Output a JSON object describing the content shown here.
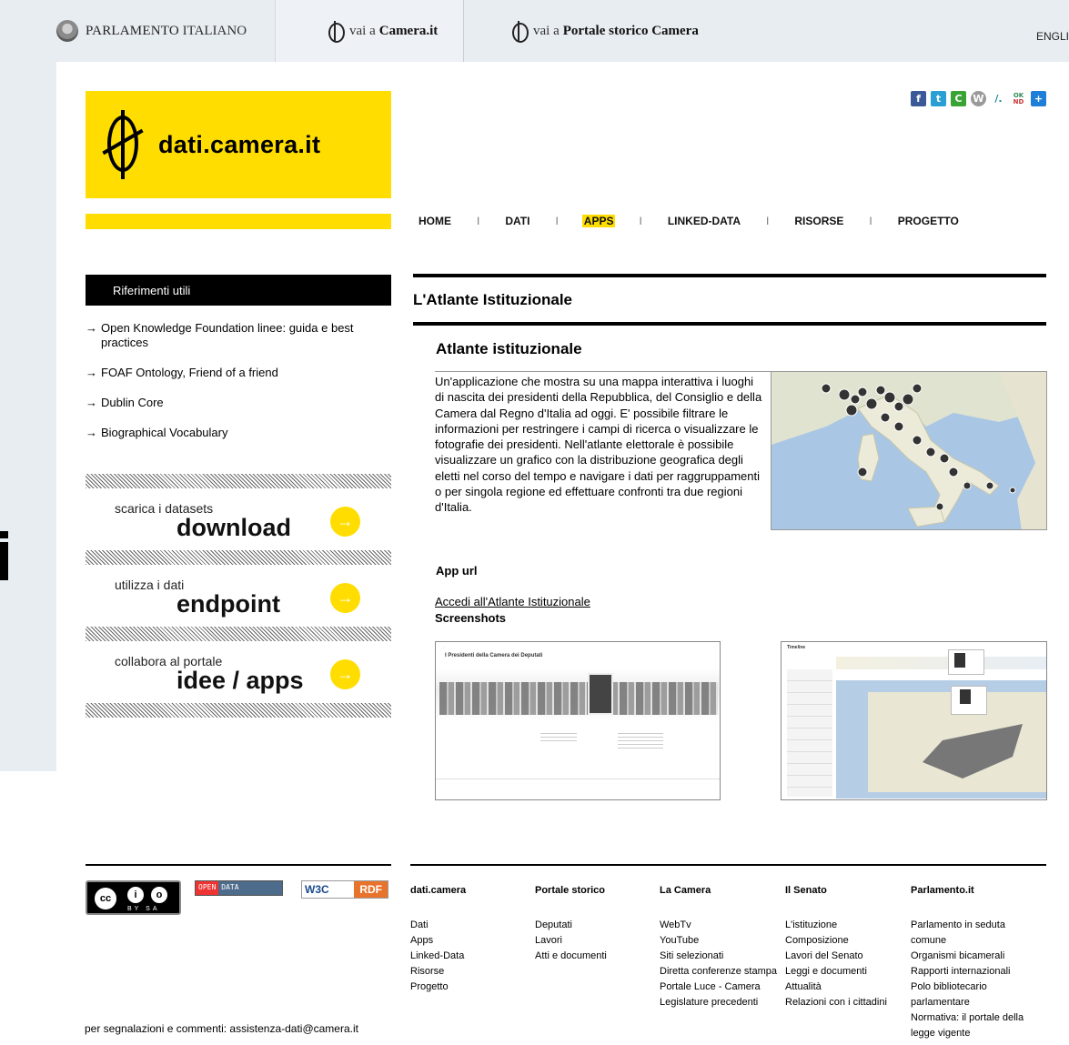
{
  "topbar": {
    "parlamento_strong": "PARLAMENTO",
    "parlamento_rest": "ITALIANO",
    "camera_prefix": "vai a",
    "camera_label": "Camera.it",
    "storico_prefix": "vai a",
    "storico_label": "Portale storico Camera",
    "lang": "ENGLI"
  },
  "logo": {
    "text": "dati.camera.it"
  },
  "social_icons": [
    "facebook-icon",
    "twitter-icon",
    "identica-icon",
    "wordpress-icon",
    "slash-icon",
    "okfn-icon",
    "add-icon"
  ],
  "nav": {
    "items": [
      {
        "label": "HOME"
      },
      {
        "label": "DATI"
      },
      {
        "label": "APPS",
        "active": true
      },
      {
        "label": "LINKED-DATA"
      },
      {
        "label": "RISORSE"
      },
      {
        "label": "PROGETTO"
      }
    ],
    "separator": "I"
  },
  "sidebar": {
    "heading": "Riferimenti utili",
    "links": [
      "Open Knowledge Foundation linee: guida e best practices",
      "FOAF Ontology, Friend of a friend",
      "Dublin Core",
      "Biographical Vocabulary"
    ],
    "arrow": "→",
    "blocks": [
      {
        "small": "scarica i datasets",
        "big": "download",
        "btn": "→"
      },
      {
        "small": "utilizza i dati",
        "big": "endpoint",
        "btn": "→"
      },
      {
        "small": "collabora al portale",
        "big": "idee / apps",
        "btn": "→"
      }
    ]
  },
  "main": {
    "page_title": "L'Atlante Istituzionale",
    "app_title": "Atlante istituzionale",
    "description": "Un'applicazione che mostra su una mappa interattiva i luoghi di nascita dei presidenti della Repubblica, del Consiglio e della Camera dal Regno d'Italia ad oggi. E' possibile filtrare le informazioni per restringere i campi di ricerca o visualizzare le fotografie dei presidenti. Nell'atlante elettorale è possibile visualizzare un grafico con la distribuzione geografica degli eletti nel corso del tempo e navigare i dati per raggruppamenti o per singola regione ed effettuare confronti tra due regioni d'Italia.",
    "app_url_label": "App url",
    "app_link": "Accedi all'Atlante Istituzionale",
    "screenshots_label": "Screenshots",
    "shot1_title": "I Presidenti della Camera dei Deputati",
    "shot2_title": "Timeline"
  },
  "footer": {
    "badges": {
      "cc_main": "cc",
      "cc_by": "i",
      "cc_sa": "o",
      "cc_caption": "BY SA",
      "opendata_open": "OPEN",
      "opendata_data": "DATA",
      "rdf_w3c": "W3C",
      "rdf_label": "RDF"
    },
    "contact": "per segnalazioni e commenti: assistenza-dati@camera.it",
    "columns": [
      {
        "title": "dati.camera",
        "links": [
          "Dati",
          "Apps",
          "Linked-Data",
          "Risorse",
          "Progetto"
        ]
      },
      {
        "title": "Portale storico",
        "links": [
          "Deputati",
          "Lavori",
          "Atti e documenti"
        ]
      },
      {
        "title": "La Camera",
        "links": [
          "WebTv",
          "YouTube",
          "Siti selezionati",
          "Diretta conferenze stampa",
          "Portale Luce - Camera",
          "Legislature precedenti"
        ]
      },
      {
        "title": "Il Senato",
        "links": [
          "L'istituzione",
          "Composizione",
          "Lavori del Senato",
          "Leggi e documenti",
          "Attualità",
          "Relazioni con i cittadini"
        ]
      },
      {
        "title": "Parlamento.it",
        "links": [
          "Parlamento in seduta comune",
          "Organismi bicamerali",
          "Rapporti internazionali",
          "Polo bibliotecario parlamentare",
          "Normativa: il portale della legge vigente"
        ]
      }
    ]
  }
}
